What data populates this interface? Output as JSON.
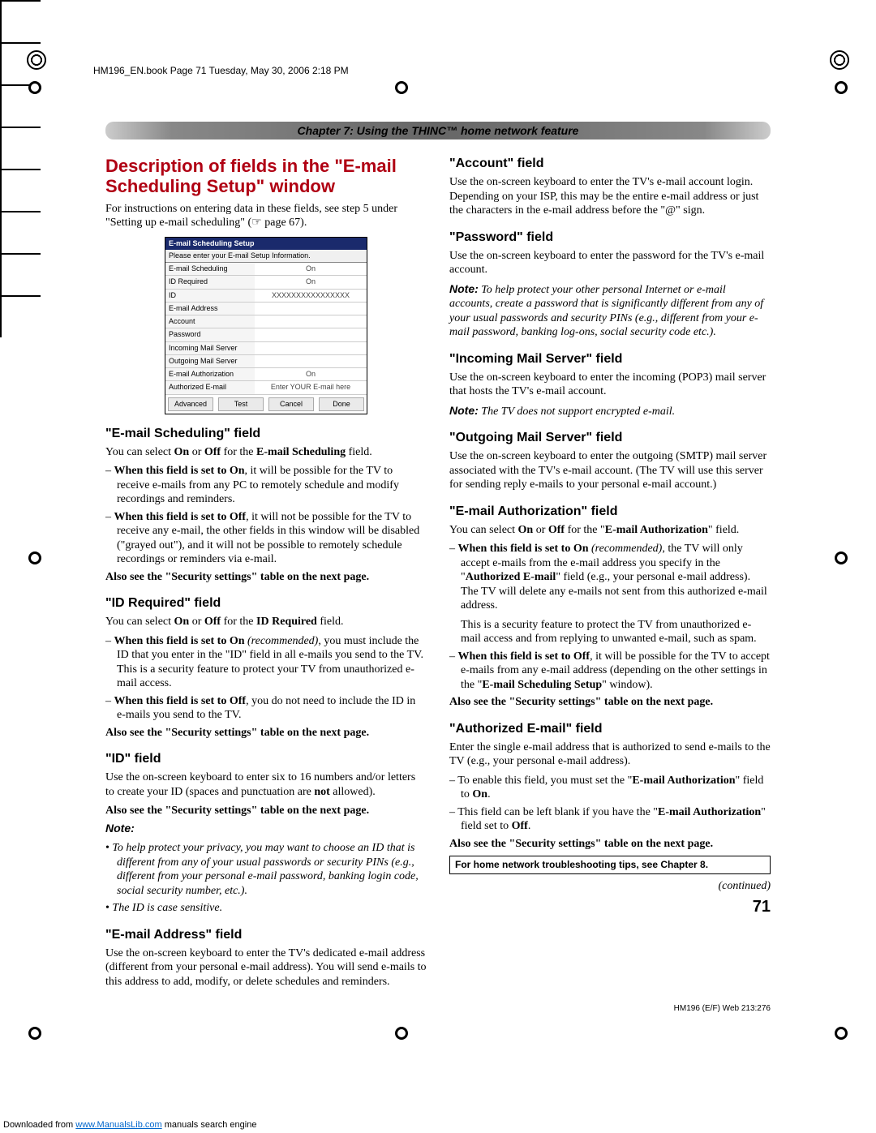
{
  "header_line": "HM196_EN.book  Page 71  Tuesday, May 30, 2006  2:18 PM",
  "chapter_bar": "Chapter 7: Using the THINC™ home network feature",
  "section_title": "Description of fields in the \"E-mail Scheduling Setup\" window",
  "intro1": "For instructions on entering data in these fields, see step 5 under \"Setting up e-mail scheduling\" (☞ page 67).",
  "dialog": {
    "title": "E-mail Scheduling Setup",
    "note": "Please enter your E-mail Setup Information.",
    "rows": [
      {
        "label": "E-mail Scheduling",
        "value": "On"
      },
      {
        "label": "ID Required",
        "value": "On"
      },
      {
        "label": "ID",
        "value": "XXXXXXXXXXXXXXXX"
      },
      {
        "label": "E-mail Address",
        "value": ""
      },
      {
        "label": "Account",
        "value": ""
      },
      {
        "label": "Password",
        "value": ""
      },
      {
        "label": "Incoming Mail Server",
        "value": ""
      },
      {
        "label": "Outgoing Mail Server",
        "value": ""
      },
      {
        "label": "E-mail Authorization",
        "value": "On"
      },
      {
        "label": "Authorized E-mail",
        "value": "Enter YOUR E-mail here"
      }
    ],
    "buttons": [
      "Advanced",
      "Test",
      "Cancel",
      "Done"
    ]
  },
  "left": {
    "f1": {
      "title": "\"E-mail Scheduling\" field",
      "p1a": "You can select ",
      "p1b": " or ",
      "p1c": " for the ",
      "p1d": " field.",
      "on": "On",
      "off": "Off",
      "fieldname": "E-mail Scheduling",
      "b1a": "When this field is set to On",
      "b1b": ", it will be possible for the TV to receive e-mails from any PC to remotely schedule and modify recordings and reminders.",
      "b2a": "When this field is set to Off",
      "b2b": ", it will not be possible for the TV to receive any e-mail, the other fields in this window will be disabled (\"grayed out\"), and it will not be possible to remotely schedule recordings or reminders via e-mail.",
      "also": "Also see the \"Security settings\" table on the next page."
    },
    "f2": {
      "title": "\"ID Required\" field",
      "p1a": "You can select ",
      "p1b": " or ",
      "p1c": " for the ",
      "p1d": " field.",
      "on": "On",
      "off": "Off",
      "fieldname": "ID Required",
      "b1a": "When this field is set to On",
      "b1rec": " (recommended)",
      "b1b": ", you must include the ID that you enter in the \"ID\" field in all e-mails you send to the TV. This is a security feature to protect your TV from unauthorized e-mail access.",
      "b2a": "When this field is set to Off",
      "b2b": ", you do not need to include the ID in e-mails you send to the TV.",
      "also": "Also see the \"Security settings\" table on the next page."
    },
    "f3": {
      "title": "\"ID\" field",
      "p1": "Use the on-screen keyboard to enter six to 16 numbers and/or letters to create your ID (spaces and punctuation are ",
      "p1not": "not",
      "p1end": " allowed).",
      "also": "Also see the \"Security settings\" table on the next page.",
      "notelabel": "Note:",
      "n1": "To help protect your privacy, you may want to choose an ID that is different from any of your usual passwords or security PINs (e.g., different from your personal e-mail password, banking login code, social security number, etc.).",
      "n2": "The ID is case sensitive."
    },
    "f4": {
      "title": "\"E-mail Address\" field",
      "p1": "Use the on-screen keyboard to enter the TV's dedicated e-mail address (different from your personal e-mail address). You will send e-mails to this address to add, modify, or delete schedules and reminders."
    }
  },
  "right": {
    "f5": {
      "title": "\"Account\" field",
      "p1": "Use the on-screen keyboard to enter the TV's e-mail account login. Depending on your ISP, this may be the entire e-mail address or just the characters in the e-mail address before the \"@\" sign."
    },
    "f6": {
      "title": "\"Password\" field",
      "p1": "Use the on-screen keyboard to enter the password for the TV's e-mail account.",
      "notelabel": "Note:",
      "note": " To help protect your other personal Internet or e-mail accounts, create a password that is significantly different from any of your usual passwords and security PINs (e.g., different from your e-mail password, banking log-ons, social security code etc.)."
    },
    "f7": {
      "title": "\"Incoming Mail Server\" field",
      "p1": "Use the on-screen keyboard to enter the incoming (POP3) mail server that hosts the TV's e-mail account.",
      "notelabel": "Note:",
      "note": " The TV does not support encrypted e-mail."
    },
    "f8": {
      "title": "\"Outgoing Mail Server\" field",
      "p1": "Use the on-screen keyboard to enter the outgoing (SMTP) mail server associated with the TV's e-mail account. (The TV will use this server for sending reply e-mails to your personal e-mail account.)"
    },
    "f9": {
      "title": "\"E-mail Authorization\" field",
      "p1a": "You can select ",
      "on": "On",
      "p1b": " or ",
      "off": "Off",
      "p1c": " for the \"",
      "fieldname": "E-mail Authorization",
      "p1d": "\"",
      "p1e": " field.",
      "b1a": "When this field is set to On",
      "b1rec": " (recommended)",
      "b1b": ", the TV will only accept e-mails from the e-mail address you specify in the \"",
      "b1c": "Authorized E-mail",
      "b1d": "\" field (e.g., your personal e-mail address). The TV will delete any e-mails not sent from this authorized e-mail address.",
      "b1e": "This is a security feature to protect the TV from unauthorized e-mail access and from replying to unwanted e-mail, such as spam.",
      "b2a": "When this field is set to Off",
      "b2b": ", it will be possible for the TV to accept e-mails from any e-mail address (depending on the other settings in the \"",
      "b2c": "E-mail Scheduling Setup",
      "b2d": "\" window).",
      "also": "Also see the \"Security settings\" table on the next page."
    },
    "f10": {
      "title": "\"Authorized E-mail\" field",
      "p1": "Enter the single e-mail address that is authorized to send e-mails to the TV (e.g., your personal e-mail address).",
      "b1a": "To enable this field, you must set the \"",
      "b1b": "E-mail Authorization",
      "b1c": "\" field  to ",
      "b1d": "On",
      "b1e": ".",
      "b2a": "This field can be left blank if you have the \"",
      "b2b": "E-mail Authorization",
      "b2c": "\" field set to ",
      "b2d": "Off",
      "b2e": ".",
      "also": "Also see the \"Security settings\" table on the next page.",
      "box": "For home network troubleshooting tips, see Chapter 8."
    },
    "continued": "(continued)",
    "pagenum": "71"
  },
  "footer": "HM196 (E/F) Web 213:276",
  "download": {
    "pre": "Downloaded from ",
    "url": "www.ManualsLib.com",
    "post": " manuals search engine"
  }
}
